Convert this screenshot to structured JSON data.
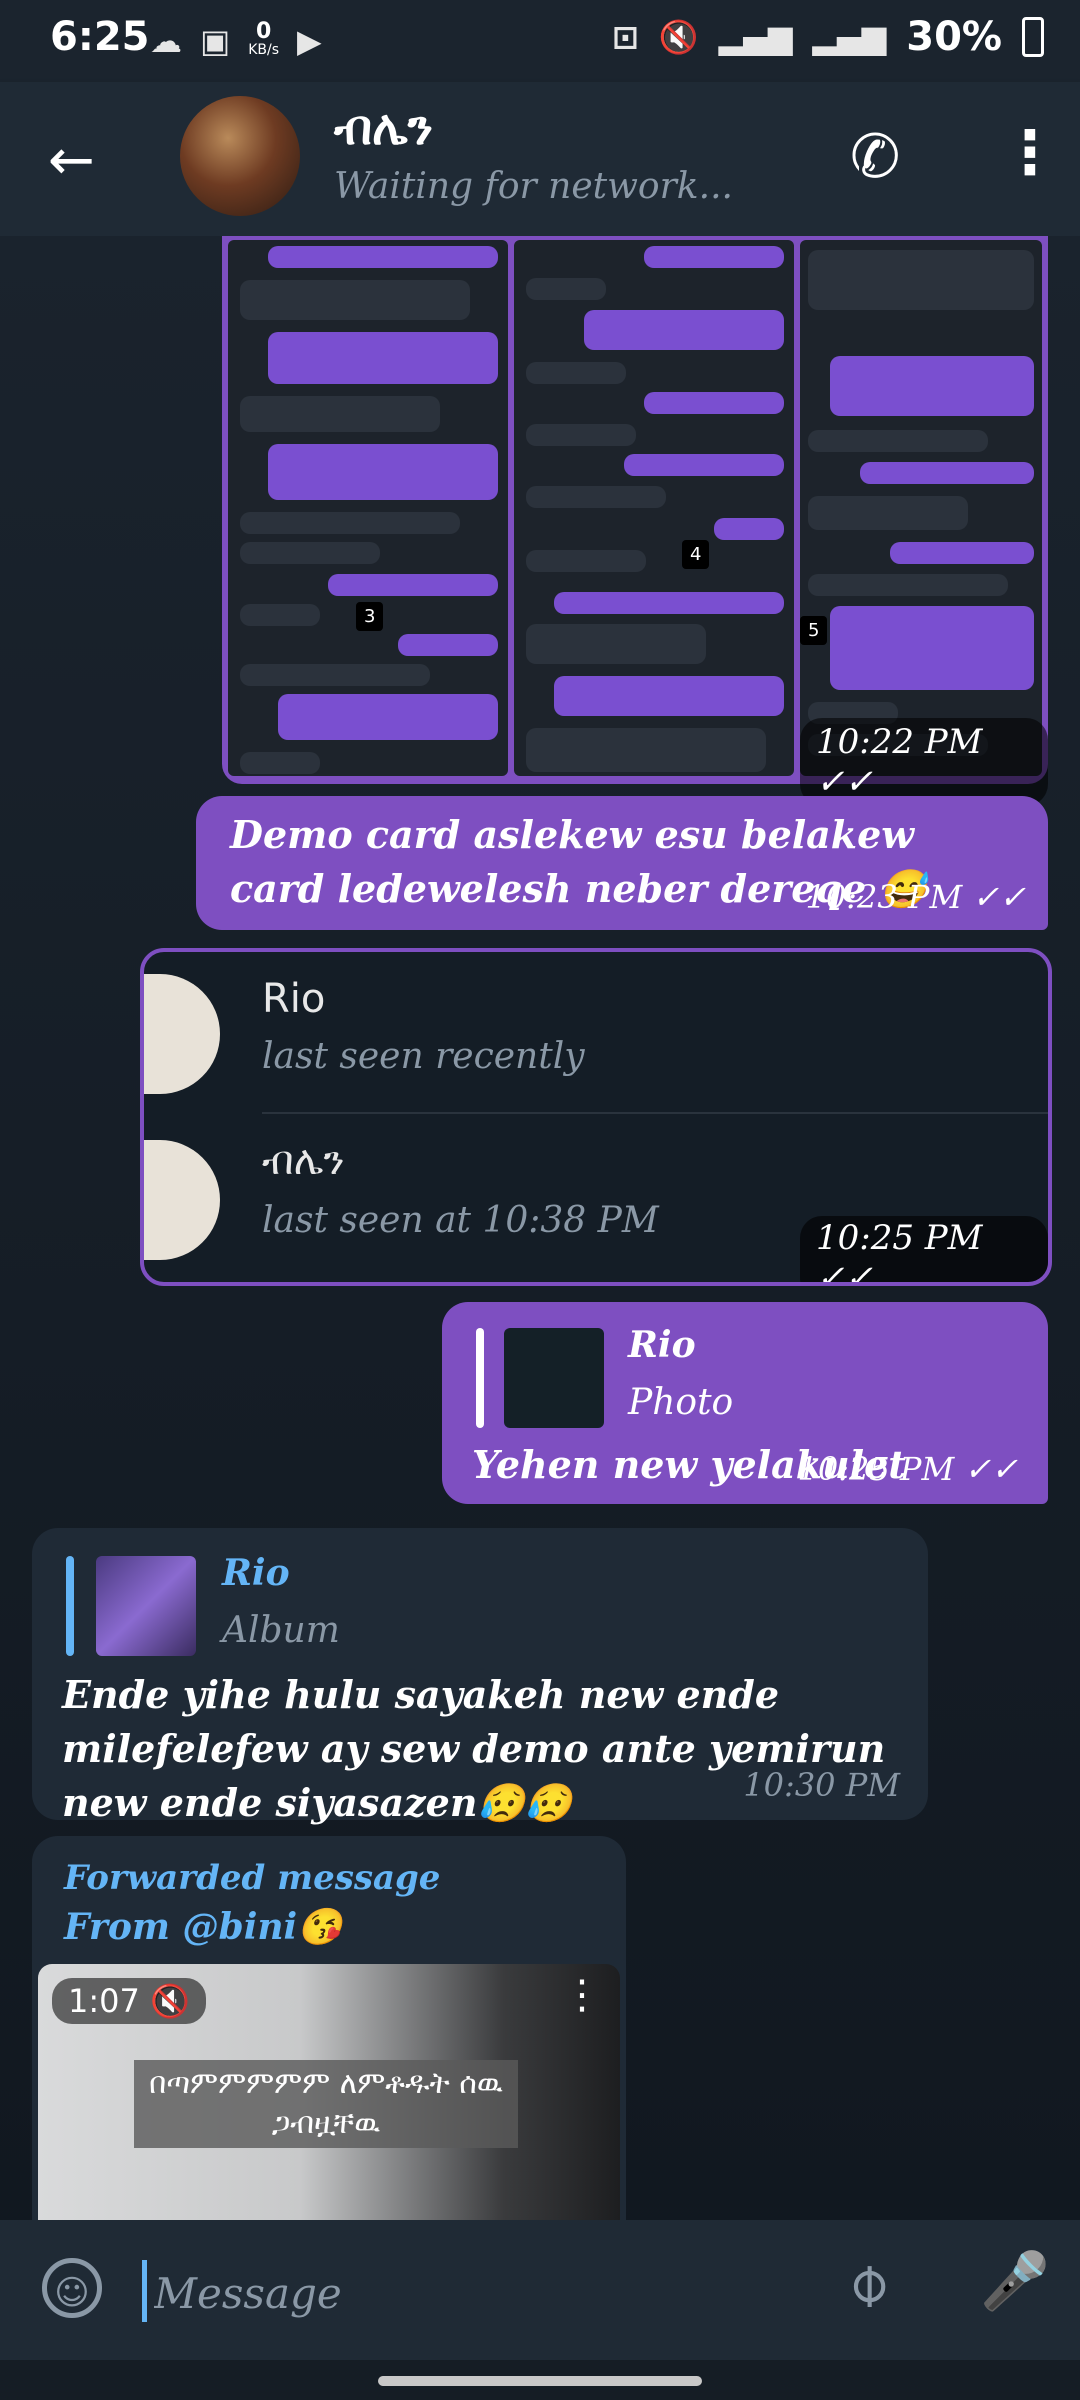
{
  "status_bar": {
    "time": "6:25",
    "speed_value": "0",
    "speed_unit": "KB/s",
    "battery": "30%"
  },
  "header": {
    "name": "ብሌን",
    "status": "Waiting for network..."
  },
  "album": {
    "time": "10:22 PM"
  },
  "messages": {
    "m1": {
      "text": "Demo card aslekew esu belakew card ledewelesh neber dereqe 😅",
      "time": "10:23 PM"
    },
    "contacts": {
      "items": [
        {
          "name": "Rio",
          "status": "last seen recently"
        },
        {
          "name": "ብሌን",
          "status": "last seen at 10:38 PM"
        }
      ],
      "time": "10:25 PM"
    },
    "m3": {
      "reply_name": "Rio",
      "reply_type": "Photo",
      "text": "Yehen new yelakulet",
      "time": "10:25 PM"
    },
    "m4": {
      "reply_name": "Rio",
      "reply_type": "Album",
      "text": "Ende yihe hulu sayakeh new ende milefelefew ay sew demo ante yemirun new ende siyasazen😥😥",
      "time": "10:30 PM"
    },
    "m5": {
      "forwarded_label": "Forwarded message",
      "from": "From @bini😘",
      "duration": "1:07",
      "caption": "በጣምምምምም ለምቶዱት ሰዉ ጋብዟቸዉ"
    }
  },
  "composer": {
    "placeholder": "Message"
  },
  "icons": {
    "back": "back-arrow-icon",
    "call": "phone-icon",
    "menu": "more-vertical-icon",
    "emoji": "emoji-icon",
    "attach": "paperclip-icon",
    "mic": "microphone-icon",
    "mute": "muted-speaker-icon"
  },
  "colors": {
    "outgoing_bubble": "#7e4fc1",
    "incoming_bubble": "#1f2a36",
    "accent": "#64b5f6",
    "background": "#17202a"
  }
}
